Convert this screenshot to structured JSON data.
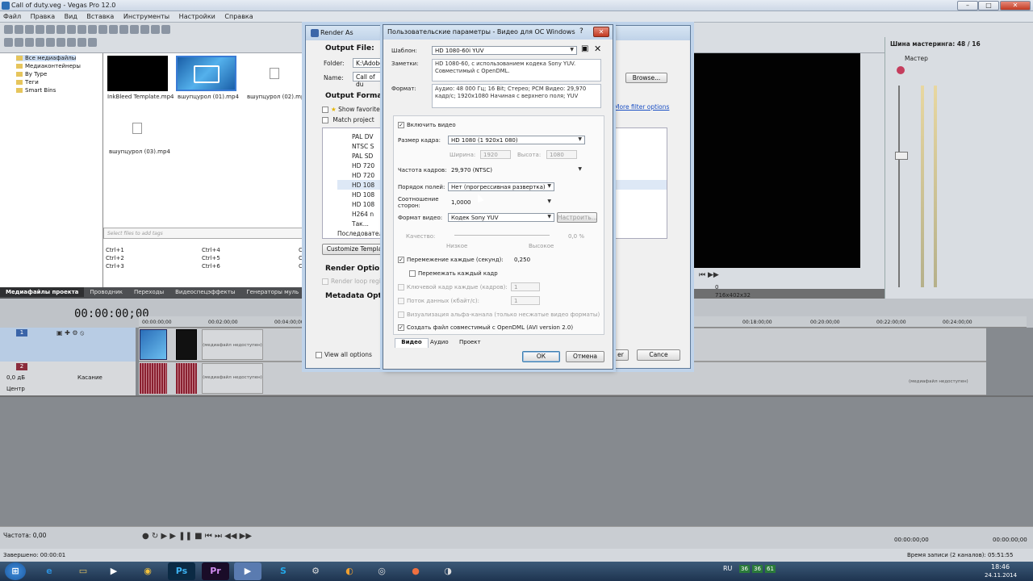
{
  "window": {
    "title": "Call of duty.veg - Vegas Pro 12.0"
  },
  "menu": [
    "Файл",
    "Правка",
    "Вид",
    "Вставка",
    "Инструменты",
    "Настройки",
    "Справка"
  ],
  "explorer": {
    "items": [
      "Все медиафайлы",
      "Медиаконтейнеры",
      "By Type",
      "Теги",
      "Smart Bins"
    ]
  },
  "media": {
    "files": [
      "InkBleed Template.mp4",
      "вшупцурол (01).mp4",
      "вшупцурол (02).mp4",
      "вшупцурол (03).mp4"
    ],
    "tag_placeholder": "Select files to add tags",
    "shortcuts": [
      [
        "Ctrl+1",
        "Ctrl+4",
        "Ctrl+7"
      ],
      [
        "Ctrl+2",
        "Ctrl+5",
        "Ctrl+8"
      ],
      [
        "Ctrl+3",
        "Ctrl+6",
        "Ctrl+9"
      ]
    ]
  },
  "bottom_tabs": [
    "Медиафайлы проекта",
    "Проводник",
    "Переходы",
    "Видеоспецэффекты",
    "Генераторы муль"
  ],
  "master": {
    "title": "Шина мастеринга: 48 / 16",
    "label": "Мастер"
  },
  "preview": {
    "info_a": "0",
    "info_b": "716x402x32"
  },
  "timeline": {
    "timecode": "00:00:00;00",
    "ruler": [
      "00:00:00;00",
      "00:02:00;00",
      "00:04:00;00",
      "00:18:00;00",
      "00:20:00;00",
      "00:22:00;00",
      "00:24:00;00"
    ],
    "track1": {
      "num": "1"
    },
    "track2": {
      "num": "2",
      "volume": "0,0 дБ",
      "mode": "Касание",
      "pan": "Центр"
    },
    "offline": "(медиафайл недоступен)"
  },
  "status": {
    "left": "Завершено: 00:00:01",
    "rate": "Частота: 0,00",
    "right": "Время записи (2 каналов): 05:51:55",
    "tc1": "00:00:00;00",
    "tc2": "00:00:00;00"
  },
  "taskbar": {
    "lang": "RU",
    "time": "18:46",
    "date": "24.11.2014",
    "tray": [
      "36",
      "36",
      "61"
    ]
  },
  "render_as": {
    "title": "Render As",
    "output_file": "Output File:",
    "folder_label": "Folder:",
    "folder_value": "K:\\Adobe",
    "name_label": "Name:",
    "name_value": "Call of du",
    "browse": "Browse...",
    "output_format": "Output Format:",
    "show_favorites": "Show favorite",
    "match_project": "Match project",
    "formats": [
      "PAL DV",
      "NTSC S",
      "PAL SD",
      "HD 720",
      "HD 720",
      "HD 108",
      "HD 108",
      "HD 108",
      "H264 n",
      "Tак..."
    ],
    "sequence": "Последовательно",
    "more_filter": "More filter options",
    "customize": "Customize Templa",
    "render_options": "Render Options:",
    "render_loop": "Render loop region",
    "metadata": "Metadata Option",
    "view_all": "View all options",
    "cancel": "Cance",
    "render": "er"
  },
  "custom": {
    "title": "Пользовательские параметры - Видео для ОС Windows",
    "template_label": "Шаблон:",
    "template_value": "HD 1080-60i YUV",
    "notes_label": "Заметки:",
    "notes_value": "HD 1080-60, с использованием кодека Sony YUV. Совместимый с OpenDML.",
    "format_label": "Формат:",
    "format_value": "Аудио: 48 000 Гц; 16 Bit; Стерео; PCM Видео: 29,970 кадр/с; 1920x1080 Начиная с верхнего поля; YUV",
    "enable_video": "Включить видео",
    "frame_size_label": "Размер кадра:",
    "frame_size_value": "HD 1080 (1 920x1 080)",
    "width_label": "Ширина:",
    "width_value": "1920",
    "height_label": "Высота:",
    "height_value": "1080",
    "frame_rate_label": "Частота кадров:",
    "frame_rate_value": "29,970 (NTSC)",
    "field_order_label": "Порядок полей:",
    "field_order_value": "Нет (прогрессивная развертка)",
    "aspect_label": "Соотношение сторон:",
    "aspect_value": "1,0000",
    "video_format_label": "Формат видео:",
    "video_format_value": "Кодек Sony YUV",
    "configure": "Настроить...",
    "quality_label": "Качество:",
    "quality_low": "Низкое",
    "quality_high": "Высокое",
    "quality_value": "0,0 %",
    "interleave_label": "Перемежение каждые (секунд):",
    "interleave_value": "0,250",
    "interleave_frame": "Перемежать каждый кадр",
    "keyframe_label": "Ключевой кадр каждые (кадров):",
    "keyframe_value": "1",
    "datarate_label": "Поток данных (кбайт/с):",
    "datarate_value": "1",
    "alpha": "Визуализация альфа-канала (только несжатые видео форматы)",
    "opendml": "Создать файл совместимый с OpenDML (AVI version 2.0)",
    "tabs": [
      "Видео",
      "Аудио",
      "Проект"
    ],
    "ok": "ОК",
    "cancel": "Отмена"
  }
}
